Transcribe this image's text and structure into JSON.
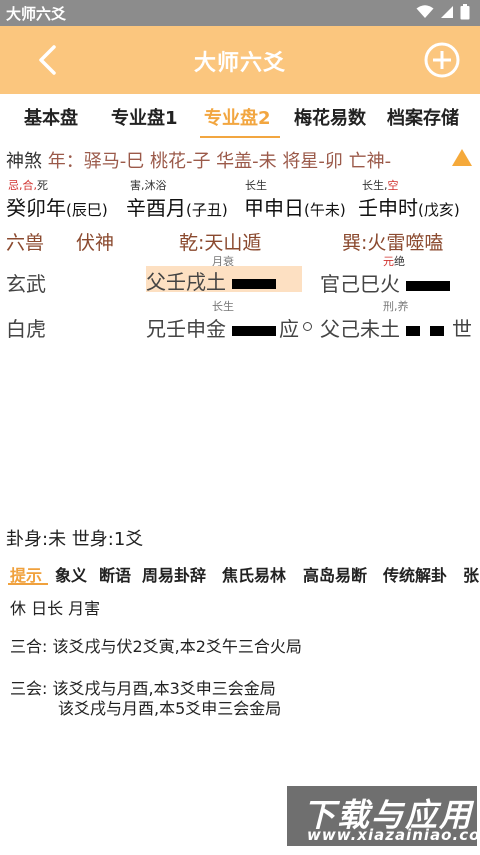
{
  "status_bar": {
    "title": "大师六爻"
  },
  "app_bar": {
    "title": "大师六爻"
  },
  "tabs": [
    "基本盘",
    "专业盘1",
    "专业盘2",
    "梅花易数",
    "档案存储"
  ],
  "shensha": {
    "label": "神煞",
    "text": "年：驿马-巳 桃花-子 华盖-未 将星-卯 亡神-"
  },
  "ganzhi": [
    {
      "tag_red": "忌,合,",
      "tag_dark": "死",
      "text": "癸卯年",
      "paren": "(辰巳)"
    },
    {
      "tag_red": "",
      "tag_dark": "害,沐浴",
      "text": "辛酉月",
      "paren": "(子丑)"
    },
    {
      "tag_red": "",
      "tag_dark": "长生",
      "text": "甲申日",
      "paren": "(午未)"
    },
    {
      "tag_red": "空",
      "tag_dark": "长生,",
      "text": "壬申时",
      "paren": "(戊亥)"
    }
  ],
  "header": {
    "liushou": "六兽",
    "fushen": "伏神",
    "main_hex": "乾:天山遁",
    "changed_hex": "巽:火雷噬嗑"
  },
  "yao_rows": [
    {
      "beast": "玄武",
      "main_small": "月衰",
      "main": "父壬戌土",
      "changed_small_red": "元",
      "changed_small": "绝",
      "changed": "官己巳火",
      "marker": ""
    },
    {
      "beast": "白虎",
      "main_small": "长生",
      "main": "兄壬申金",
      "ying": "应",
      "changed_small": "刑,养",
      "changed": "父己未土",
      "marker": "世"
    }
  ],
  "guashen": "卦身:未 世身:1爻",
  "subtabs": [
    "提示",
    "象义",
    "断语",
    "周易卦辞",
    "焦氏易林",
    "高岛易断",
    "传统解卦",
    "张"
  ],
  "hints": {
    "line1": "休 日长 月害",
    "sanhe": "三合:  该爻戌与伏2爻寅,本2爻午三合火局",
    "sanhui_1": "三会:  该爻戌与月酉,本3爻申三会金局",
    "sanhui_2": "该爻戌与月酉,本5爻申三会金局"
  },
  "watermark": {
    "main": "下载与应用",
    "sub": "www.xiazainiao.com"
  },
  "colors": {
    "app_bar": "#fbc67e",
    "accent": "#f2a640",
    "status_bar": "#8c8c8c",
    "red_tag": "#d0312d"
  }
}
